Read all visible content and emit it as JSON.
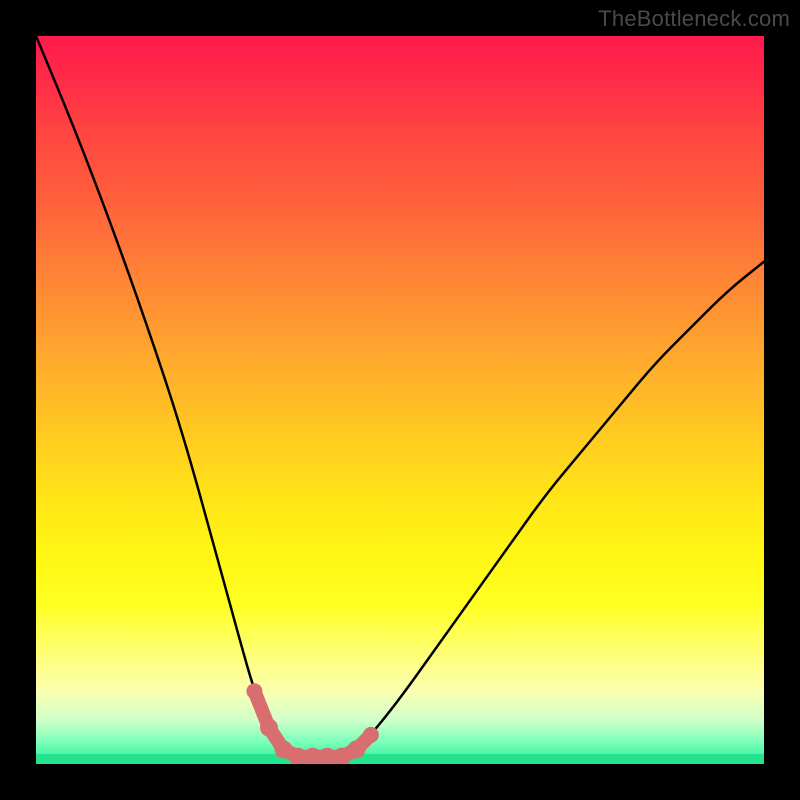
{
  "watermark": "TheBottleneck.com",
  "colors": {
    "background": "#000000",
    "curve": "#000000",
    "marker": "#d86e70",
    "green": "#24e28e"
  },
  "chart_data": {
    "type": "line",
    "title": "",
    "xlabel": "",
    "ylabel": "",
    "xlim": [
      0,
      100
    ],
    "ylim": [
      0,
      100
    ],
    "grid": false,
    "legend": false,
    "series": [
      {
        "name": "bottleneck-curve",
        "x": [
          0,
          5,
          10,
          15,
          20,
          25,
          28,
          30,
          32,
          34,
          36,
          38,
          40,
          42,
          44,
          46,
          50,
          55,
          60,
          65,
          70,
          75,
          80,
          85,
          90,
          95,
          100
        ],
        "y": [
          100,
          88,
          75,
          61,
          46,
          28,
          17,
          10,
          5,
          2,
          1,
          1,
          1,
          1,
          2,
          4,
          9,
          16,
          23,
          30,
          37,
          43,
          49,
          55,
          60,
          65,
          69
        ]
      }
    ],
    "markers": {
      "name": "trough-markers",
      "x": [
        30,
        32,
        34,
        36,
        38,
        40,
        42,
        44,
        46
      ],
      "y": [
        10,
        5,
        2,
        1,
        1,
        1,
        1,
        2,
        4
      ]
    }
  }
}
